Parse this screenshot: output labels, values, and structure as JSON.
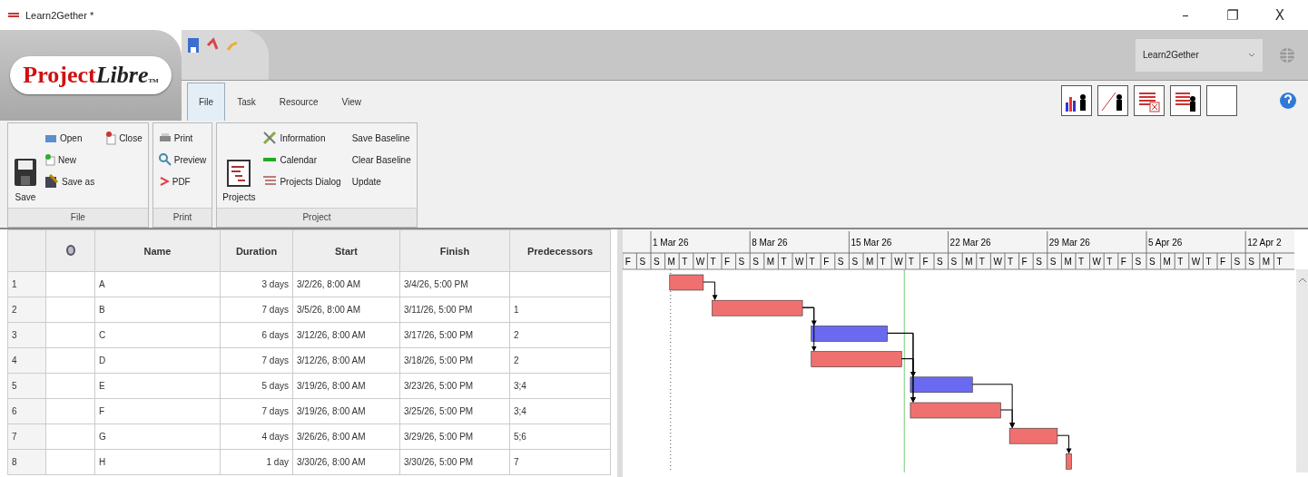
{
  "window": {
    "title": "Learn2Gether *",
    "controls": [
      "–",
      "❐",
      "X"
    ]
  },
  "header": {
    "logo_main": "Project",
    "logo_accent": "Libre",
    "logo_mark": "TM",
    "project_select": "Learn2Gether"
  },
  "tabs": [
    {
      "label": "File",
      "selected": true
    },
    {
      "label": "Task",
      "selected": false
    },
    {
      "label": "Resource",
      "selected": false
    },
    {
      "label": "View",
      "selected": false
    }
  ],
  "ribbon": {
    "groups": [
      {
        "label": "File",
        "large": {
          "label": "Save",
          "kind": "save"
        },
        "items": [
          {
            "label": "Open",
            "kind": "open"
          },
          {
            "label": "New",
            "kind": "new"
          },
          {
            "label": "Save as",
            "kind": "saveas"
          },
          {
            "label": "Close",
            "kind": "close"
          }
        ]
      },
      {
        "label": "Print",
        "items": [
          {
            "label": "Print",
            "kind": "print"
          },
          {
            "label": "Preview",
            "kind": "preview"
          },
          {
            "label": "PDF",
            "kind": "pdf"
          }
        ]
      },
      {
        "label": "Project",
        "large": {
          "label": "Projects",
          "kind": "projects"
        },
        "items": [
          {
            "label": "Information",
            "kind": "info"
          },
          {
            "label": "Calendar",
            "kind": "calendar"
          },
          {
            "label": "Projects Dialog",
            "kind": "dialog"
          },
          {
            "label": "Save Baseline",
            "kind": "text"
          },
          {
            "label": "Clear Baseline",
            "kind": "text"
          },
          {
            "label": "Update",
            "kind": "text"
          }
        ]
      }
    ]
  },
  "table": {
    "columns": [
      "Name",
      "Duration",
      "Start",
      "Finish",
      "Predecessors"
    ],
    "rows": [
      {
        "id": "1",
        "name": "A",
        "duration": "3 days",
        "start": "3/2/26, 8:00 AM",
        "finish": "3/4/26, 5:00 PM",
        "predecessors": "",
        "color": "#f07070"
      },
      {
        "id": "2",
        "name": "B",
        "duration": "7 days",
        "start": "3/5/26, 8:00 AM",
        "finish": "3/11/26, 5:00 PM",
        "predecessors": "1",
        "color": "#f07070"
      },
      {
        "id": "3",
        "name": "C",
        "duration": "6 days",
        "start": "3/12/26, 8:00 AM",
        "finish": "3/17/26, 5:00 PM",
        "predecessors": "2",
        "color": "#6a6af0"
      },
      {
        "id": "4",
        "name": "D",
        "duration": "7 days",
        "start": "3/12/26, 8:00 AM",
        "finish": "3/18/26, 5:00 PM",
        "predecessors": "2",
        "color": "#f07070"
      },
      {
        "id": "5",
        "name": "E",
        "duration": "5 days",
        "start": "3/19/26, 8:00 AM",
        "finish": "3/23/26, 5:00 PM",
        "predecessors": "3;4",
        "color": "#6a6af0"
      },
      {
        "id": "6",
        "name": "F",
        "duration": "7 days",
        "start": "3/19/26, 8:00 AM",
        "finish": "3/25/26, 5:00 PM",
        "predecessors": "3;4",
        "color": "#f07070"
      },
      {
        "id": "7",
        "name": "G",
        "duration": "4 days",
        "start": "3/26/26, 8:00 AM",
        "finish": "3/29/26, 5:00 PM",
        "predecessors": "5;6",
        "color": "#f07070"
      },
      {
        "id": "8",
        "name": "H",
        "duration": "1 day",
        "start": "3/30/26, 8:00 AM",
        "finish": "3/30/26, 5:00 PM",
        "predecessors": "7",
        "color": "#f07070"
      }
    ]
  },
  "gantt": {
    "day_letters": [
      "F",
      "S",
      "S",
      "M",
      "T",
      "W",
      "T",
      "F",
      "S",
      "S",
      "M",
      "T",
      "W",
      "T",
      "F",
      "S",
      "S",
      "M",
      "T",
      "W",
      "T",
      "F",
      "S",
      "S",
      "M",
      "T",
      "W",
      "T",
      "F",
      "S",
      "S",
      "M",
      "T",
      "W",
      "T",
      "F",
      "S",
      "S",
      "M",
      "T",
      "W",
      "T",
      "F",
      "S",
      "S",
      "M",
      "T"
    ],
    "week_labels": [
      "1 Mar 26",
      "8 Mar 26",
      "15 Mar 26",
      "22 Mar 26",
      "29 Mar 26",
      "5 Apr 26",
      "12 Apr 2"
    ]
  }
}
